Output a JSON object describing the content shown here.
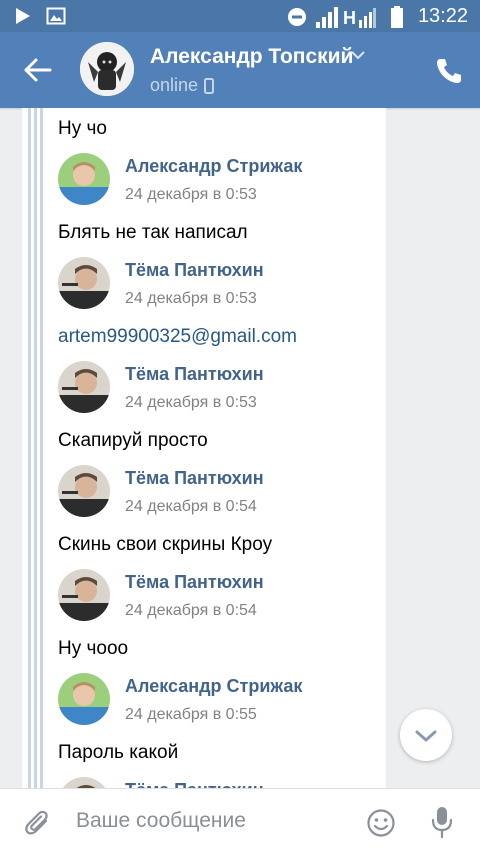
{
  "statusbar": {
    "time": "13:22",
    "network_label": "H",
    "icons": [
      "play-icon",
      "image-icon",
      "do-not-disturb-icon",
      "signal-icon",
      "battery-icon"
    ]
  },
  "header": {
    "name": "Александр Топский",
    "status": "online",
    "back_icon": "arrow-left-icon",
    "call_icon": "phone-icon",
    "colors": {
      "header_bg": "#5181b8",
      "status_bg": "#4a76a8"
    }
  },
  "messages": [
    {
      "type": "text",
      "text": "Ну чо"
    },
    {
      "type": "author",
      "name": "Александр Стрижак",
      "time": "24 декабря в 0:53",
      "avatar": "avatar-strizhak"
    },
    {
      "type": "text",
      "text": "Блять не так написал"
    },
    {
      "type": "author",
      "name": "Тёма Пантюхин",
      "time": "24 декабря в 0:53",
      "avatar": "avatar-pantyukhin"
    },
    {
      "type": "link",
      "text": "artem99900325@gmail.com"
    },
    {
      "type": "author",
      "name": "Тёма Пантюхин",
      "time": "24 декабря в 0:53",
      "avatar": "avatar-pantyukhin"
    },
    {
      "type": "text",
      "text": "Скапируй просто"
    },
    {
      "type": "author",
      "name": "Тёма Пантюхин",
      "time": "24 декабря в 0:54",
      "avatar": "avatar-pantyukhin"
    },
    {
      "type": "text",
      "text": "Скинь свои скрины Кроу"
    },
    {
      "type": "author",
      "name": "Тёма Пантюхин",
      "time": "24 декабря в 0:54",
      "avatar": "avatar-pantyukhin"
    },
    {
      "type": "text",
      "text": "Ну чооо"
    },
    {
      "type": "author",
      "name": "Александр Стрижак",
      "time": "24 декабря в 0:55",
      "avatar": "avatar-strizhak"
    },
    {
      "type": "text",
      "text": "Пароль какой"
    },
    {
      "type": "author",
      "name": "Тёма Пантюхин",
      "time": "",
      "avatar": "avatar-pantyukhin"
    }
  ],
  "composer": {
    "placeholder": "Ваше сообщение",
    "value": "",
    "icons": [
      "paperclip-icon",
      "emoji-icon",
      "microphone-icon"
    ]
  },
  "scroll_button_icon": "chevron-down-icon"
}
